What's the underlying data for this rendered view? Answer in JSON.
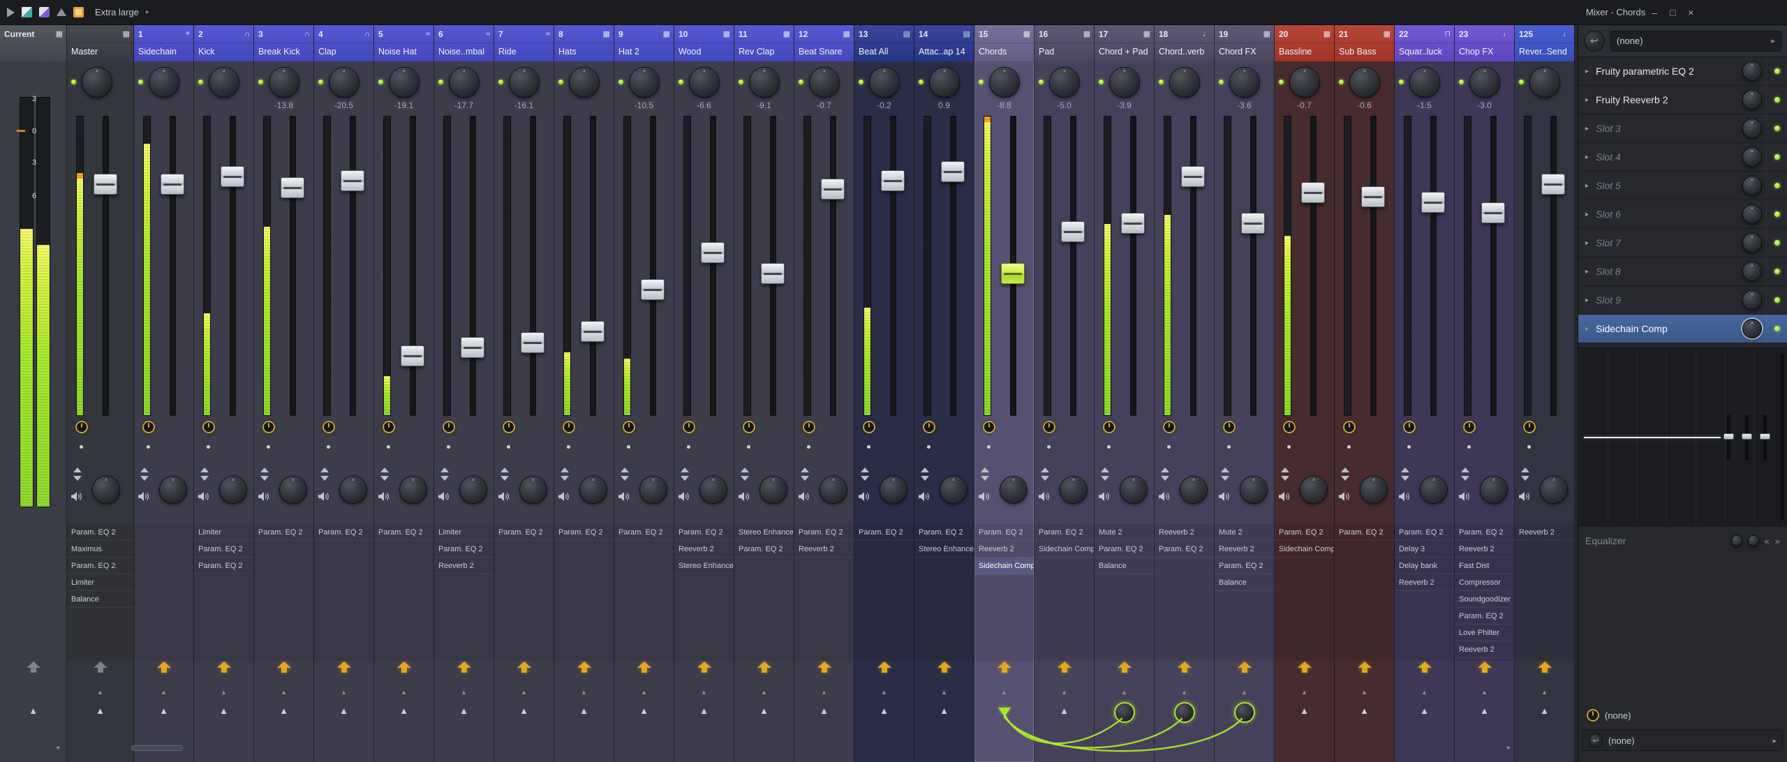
{
  "titlebar": {
    "left_label": "Extra large",
    "title": "Mixer - Chords"
  },
  "icons": {
    "tri_up": "▲",
    "tri_down": "▼",
    "chev_r": "▸",
    "chev_l": "◂",
    "min": "–",
    "max": "□",
    "close": "×",
    "route": "↩",
    "guil_l": "«",
    "guil_r": "»",
    "target": "⌖",
    "headphones": "∩",
    "grid": "▦",
    "keys": "▤",
    "mic": "♩",
    "clip": "⊓",
    "wave": "≈",
    "master": "▦"
  },
  "colors": {
    "accent": "#a9e431",
    "gold": "#e0a81e",
    "meter_top": "#f7fa6e",
    "meter_main": "#a8ea30",
    "peak_tip": "#f2a21f",
    "selected_slot": "#3f5f93",
    "groups": {
      "blue": {
        "hdr": "#4a4fd0",
        "body": "#3d3c4b"
      },
      "navy": {
        "hdr": "#2c3a96",
        "body": "#2a2d46"
      },
      "purpleSel": {
        "hdr": "#6e6794",
        "body": "#575171"
      },
      "purple": {
        "hdr": "#554e6c",
        "body": "#46415a"
      },
      "red": {
        "hdr": "#b23a2c",
        "body": "#462c2e"
      },
      "violet": {
        "hdr": "#6a4ed4",
        "body": "#3e3756"
      },
      "blue2": {
        "hdr": "#3d55cc",
        "body": "#323540"
      },
      "master": {
        "hdr": "#3c3f46",
        "body": "#33363c"
      },
      "current": {
        "hdr": "#4a4d54",
        "body": "#3a3d43"
      }
    }
  },
  "current": {
    "label": "Current",
    "scale": [
      "3",
      "0",
      "3",
      "6"
    ],
    "meters": [
      0.68,
      0.64
    ]
  },
  "master": {
    "num": "",
    "name": "Master",
    "icon": "master",
    "group": "master",
    "db": "",
    "fader": 0.208,
    "meter": 0.81,
    "tip": true,
    "dockGray": true,
    "plugins": [
      "Param. EQ 2",
      "Maximus",
      "Param. EQ 2",
      "Limiter",
      "Balance"
    ]
  },
  "tracks": [
    {
      "num": "1",
      "name": "Sidechain",
      "icon": "target",
      "group": "blue",
      "db": "",
      "fader": 0.208,
      "meter": 0.91,
      "plugins": []
    },
    {
      "num": "2",
      "name": "Kick",
      "icon": "headphones",
      "group": "blue",
      "db": "",
      "fader": 0.181,
      "meter": 0.34,
      "plugins": [
        "Limiter",
        "Param. EQ 2",
        "Param. EQ 2"
      ]
    },
    {
      "num": "3",
      "name": "Break Kick",
      "icon": "headphones",
      "group": "blue",
      "db": "-13.8",
      "fader": 0.219,
      "meter": 0.63,
      "plugins": [
        "Param. EQ 2"
      ]
    },
    {
      "num": "4",
      "name": "Clap",
      "icon": "headphones",
      "group": "blue",
      "db": "-20.5",
      "fader": 0.196,
      "meter": 0,
      "plugins": [
        "Param. EQ 2"
      ]
    },
    {
      "num": "5",
      "name": "Noise Hat",
      "icon": "wave",
      "group": "blue",
      "db": "-19.1",
      "fader": 0.823,
      "meter": 0.13,
      "plugins": [
        "Param. EQ 2"
      ]
    },
    {
      "num": "6",
      "name": "Noise..mbal",
      "icon": "wave",
      "group": "blue",
      "db": "-17.7",
      "fader": 0.792,
      "meter": 0,
      "plugins": [
        "Limiter",
        "Param. EQ 2",
        "Reeverb 2"
      ]
    },
    {
      "num": "7",
      "name": "Ride",
      "icon": "wave",
      "group": "blue",
      "db": "-16.1",
      "fader": 0.774,
      "meter": 0,
      "plugins": [
        "Param. EQ 2"
      ]
    },
    {
      "num": "8",
      "name": "Hats",
      "icon": "grid",
      "group": "blue",
      "db": "",
      "fader": 0.736,
      "meter": 0.21,
      "plugins": [
        "Param. EQ 2"
      ]
    },
    {
      "num": "9",
      "name": "Hat 2",
      "icon": "grid",
      "group": "blue",
      "db": "-10.5",
      "fader": 0.585,
      "meter": 0.19,
      "plugins": [
        "Param. EQ 2"
      ]
    },
    {
      "num": "10",
      "name": "Wood",
      "icon": "grid",
      "group": "blue",
      "db": "-6.6",
      "fader": 0.453,
      "meter": 0,
      "plugins": [
        "Param. EQ 2",
        "Reeverb 2",
        "Stereo Enhancer"
      ]
    },
    {
      "num": "11",
      "name": "Rev Clap",
      "icon": "grid",
      "group": "blue",
      "db": "-9.1",
      "fader": 0.528,
      "meter": 0,
      "plugins": [
        "Stereo Enhancer",
        "Param. EQ 2"
      ]
    },
    {
      "num": "12",
      "name": "Beat Snare",
      "icon": "grid",
      "group": "blue",
      "db": "-0.7",
      "fader": 0.226,
      "meter": 0,
      "plugins": [
        "Param. EQ 2",
        "Reeverb 2"
      ]
    },
    {
      "num": "13",
      "name": "Beat All",
      "icon": "keys",
      "group": "navy",
      "db": "-0.2",
      "fader": 0.196,
      "meter": 0.36,
      "plugins": [
        "Param. EQ 2"
      ]
    },
    {
      "num": "14",
      "name": "Attac..ap 14",
      "icon": "keys",
      "group": "navy",
      "db": "0.9",
      "fader": 0.162,
      "meter": 0,
      "plugins": [
        "Param. EQ 2",
        "Stereo Enhancer"
      ]
    },
    {
      "num": "15",
      "name": "Chords",
      "icon": "grid",
      "group": "purpleSel",
      "db": "-8.8",
      "fader": 0.528,
      "meter": 1.0,
      "tip": true,
      "sel": true,
      "selPlugin": 2,
      "sc": "source",
      "plugins": [
        "Param. EQ 2",
        "Reeverb 2",
        "Sidechain Comp"
      ]
    },
    {
      "num": "16",
      "name": "Pad",
      "icon": "grid",
      "group": "purple",
      "db": "-5.0",
      "fader": 0.377,
      "meter": 0,
      "plugins": [
        "Param. EQ 2",
        "Sidechain Comp"
      ]
    },
    {
      "num": "17",
      "name": "Chord + Pad",
      "icon": "grid",
      "group": "purple",
      "db": "-3.9",
      "fader": 0.347,
      "meter": 0.64,
      "sc": "target",
      "plugins": [
        "Mute 2",
        "Param. EQ 2",
        "Balance"
      ]
    },
    {
      "num": "18",
      "name": "Chord..verb",
      "icon": "mic",
      "group": "purple",
      "db": "",
      "fader": 0.181,
      "meter": 0.67,
      "sc": "target",
      "plugins": [
        "Reeverb 2",
        "Param. EQ 2"
      ]
    },
    {
      "num": "19",
      "name": "Chord FX",
      "icon": "grid",
      "group": "purple",
      "db": "-3.6",
      "fader": 0.347,
      "meter": 0,
      "sc": "target",
      "plugins": [
        "Mute 2",
        "Reeverb 2",
        "Param. EQ 2",
        "Balance"
      ]
    },
    {
      "num": "20",
      "name": "Bassline",
      "icon": "grid",
      "group": "red",
      "db": "-0.7",
      "fader": 0.238,
      "meter": 0.6,
      "plugins": [
        "Param. EQ 2",
        "Sidechain Comp"
      ]
    },
    {
      "num": "21",
      "name": "Sub Bass",
      "icon": "grid",
      "group": "red",
      "db": "-0.6",
      "fader": 0.253,
      "meter": 0,
      "plugins": [
        "Param. EQ 2"
      ]
    },
    {
      "num": "22",
      "name": "Squar..luck",
      "icon": "clip",
      "group": "violet",
      "db": "-1.5",
      "fader": 0.272,
      "meter": 0,
      "plugins": [
        "Param. EQ 2",
        "Delay 3",
        "Delay bank",
        "Reeverb 2"
      ]
    },
    {
      "num": "23",
      "name": "Chop FX",
      "icon": "mic",
      "group": "violet",
      "db": "-3.0",
      "fader": 0.309,
      "meter": 0,
      "plugins": [
        "Param. EQ 2",
        "Reeverb 2",
        "Fast Dist",
        "Compressor",
        "Soundgoodizer",
        "Param. EQ 2",
        "Love Philter",
        "Reeverb 2"
      ]
    },
    {
      "num": "125",
      "name": "Rever..Send",
      "icon": "mic",
      "group": "blue2",
      "db": "",
      "fader": 0.208,
      "meter": 0,
      "plugins": [
        "Reeverb 2"
      ]
    }
  ],
  "rack": {
    "route_label": "(none)",
    "slots": [
      {
        "label": "Fruity parametric EQ 2",
        "state": "filled"
      },
      {
        "label": "Fruity Reeverb 2",
        "state": "filled"
      },
      {
        "label": "Slot 3",
        "state": "empty"
      },
      {
        "label": "Slot 4",
        "state": "empty"
      },
      {
        "label": "Slot 5",
        "state": "empty"
      },
      {
        "label": "Slot 6",
        "state": "empty"
      },
      {
        "label": "Slot 7",
        "state": "empty"
      },
      {
        "label": "Slot 8",
        "state": "empty"
      },
      {
        "label": "Slot 9",
        "state": "empty"
      },
      {
        "label": "Sidechain Comp",
        "state": "selected"
      }
    ],
    "eq_label": "Equalizer",
    "time_label": "(none)",
    "send_label": "(none)"
  }
}
